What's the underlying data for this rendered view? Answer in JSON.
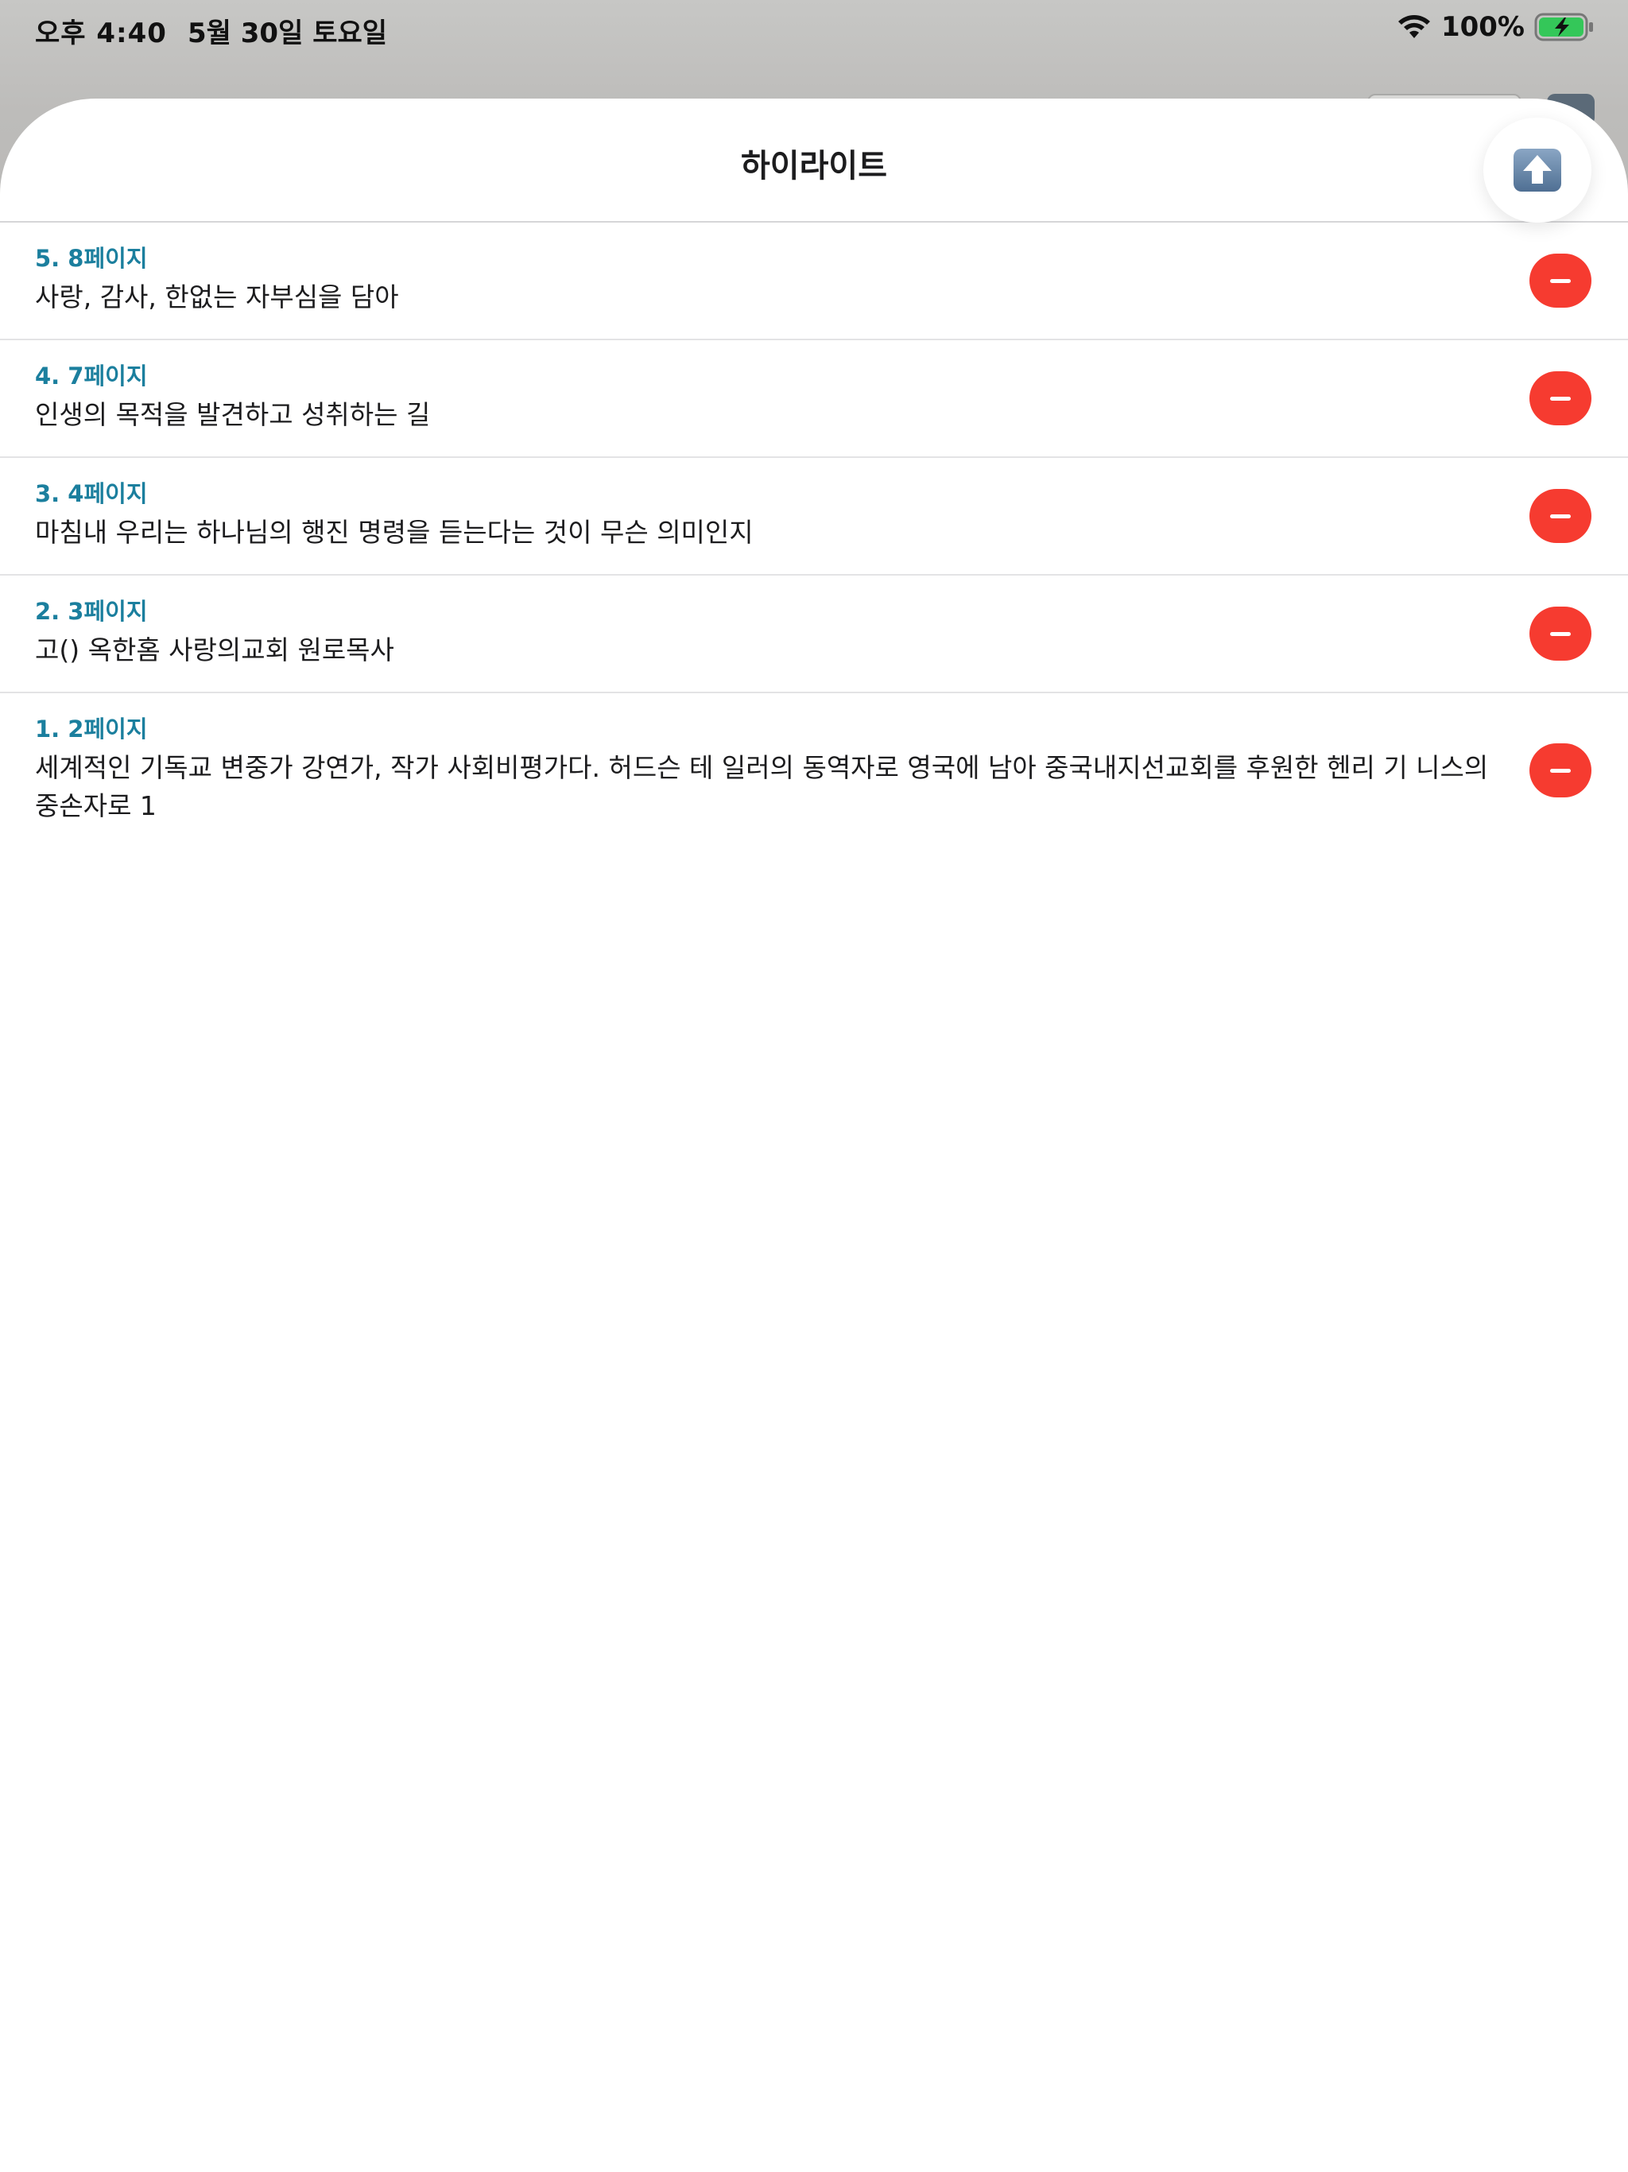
{
  "status_bar": {
    "time": "오후 4:40",
    "date": "5월 30일 토요일",
    "battery": "100%",
    "battery_color": "#34c759"
  },
  "sheet": {
    "title": "하이라이트",
    "export_icon": "upload-arrow-icon"
  },
  "highlights": [
    {
      "page": "5. 8페이지",
      "text": "사랑, 감사, 한없는 자부심을 담아"
    },
    {
      "page": "4. 7페이지",
      "text": "인생의 목적을 발견하고 성취하는 길"
    },
    {
      "page": "3. 4페이지",
      "text": "마침내 우리는 하나님의 행진 명령을 듣는다는 것이 무슨 의미인지"
    },
    {
      "page": "2. 3페이지",
      "text": "고() 옥한홈 사랑의교회 원로목사"
    },
    {
      "page": "1. 2페이지",
      "text": "세계적인 기독교 변중가 강연가, 작가 사회비평가다. 허드슨 테 일러의 동역자로 영국에 남아 중국내지선교회를 후원한 헨리 기 니스의 중손자로 1"
    }
  ],
  "colors": {
    "page_label": "#1b7f9e",
    "delete": "#f63b30"
  }
}
